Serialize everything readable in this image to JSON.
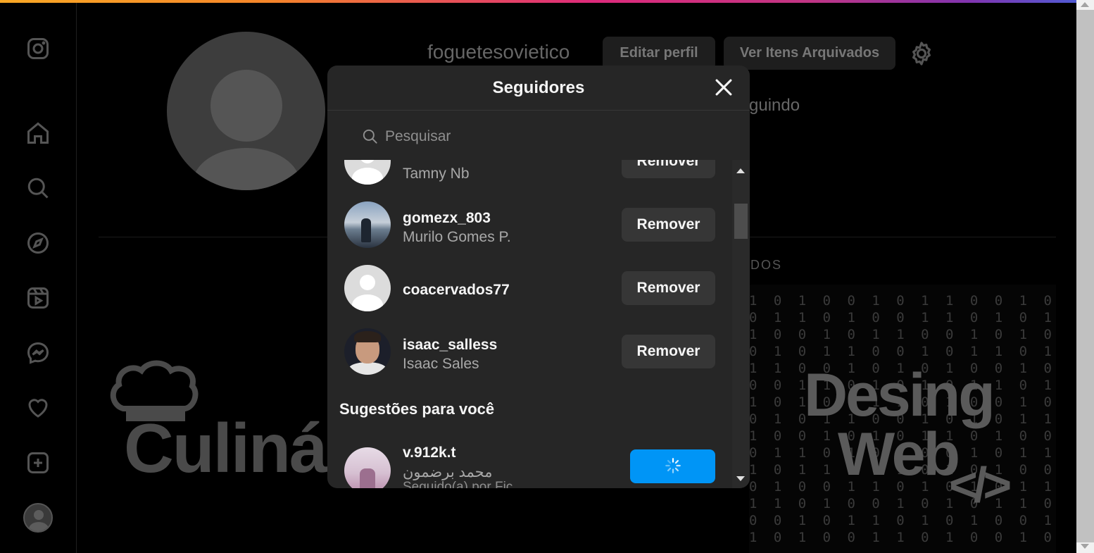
{
  "profile": {
    "username": "foguetesovietico",
    "edit_label": "Editar perfil",
    "archive_label": "Ver Itens Arquivados",
    "following_partial": "guindo",
    "tab_partial": "DOS"
  },
  "sidebar": {
    "items": [
      {
        "icon": "instagram-logo-icon"
      },
      {
        "icon": "home-icon"
      },
      {
        "icon": "search-icon"
      },
      {
        "icon": "explore-icon"
      },
      {
        "icon": "reels-icon"
      },
      {
        "icon": "messenger-icon"
      },
      {
        "icon": "heart-icon"
      },
      {
        "icon": "create-icon"
      },
      {
        "icon": "avatar"
      }
    ]
  },
  "posts": {
    "left_text": "Culinár",
    "right_line1": "Desing",
    "right_line2": "Web",
    "right_line3": "</>"
  },
  "modal": {
    "title": "Seguidores",
    "search_placeholder": "Pesquisar",
    "remove_label": "Remover",
    "followers": [
      {
        "username": "",
        "fullname": "Tamny Nb"
      },
      {
        "username": "gomezx_803",
        "fullname": "Murilo Gomes P."
      },
      {
        "username": "coacervados77",
        "fullname": ""
      },
      {
        "username": "isaac_salless",
        "fullname": "Isaac Sales"
      }
    ],
    "suggestions_title": "Sugestões para você",
    "suggestions": [
      {
        "username": "v.912k.t",
        "fullname": "محمد برضمون",
        "extra": "Seguido(a) por Fic..."
      }
    ]
  },
  "colors": {
    "accent": "#0095f6",
    "modal_bg": "#262626",
    "button_bg": "#363636"
  }
}
